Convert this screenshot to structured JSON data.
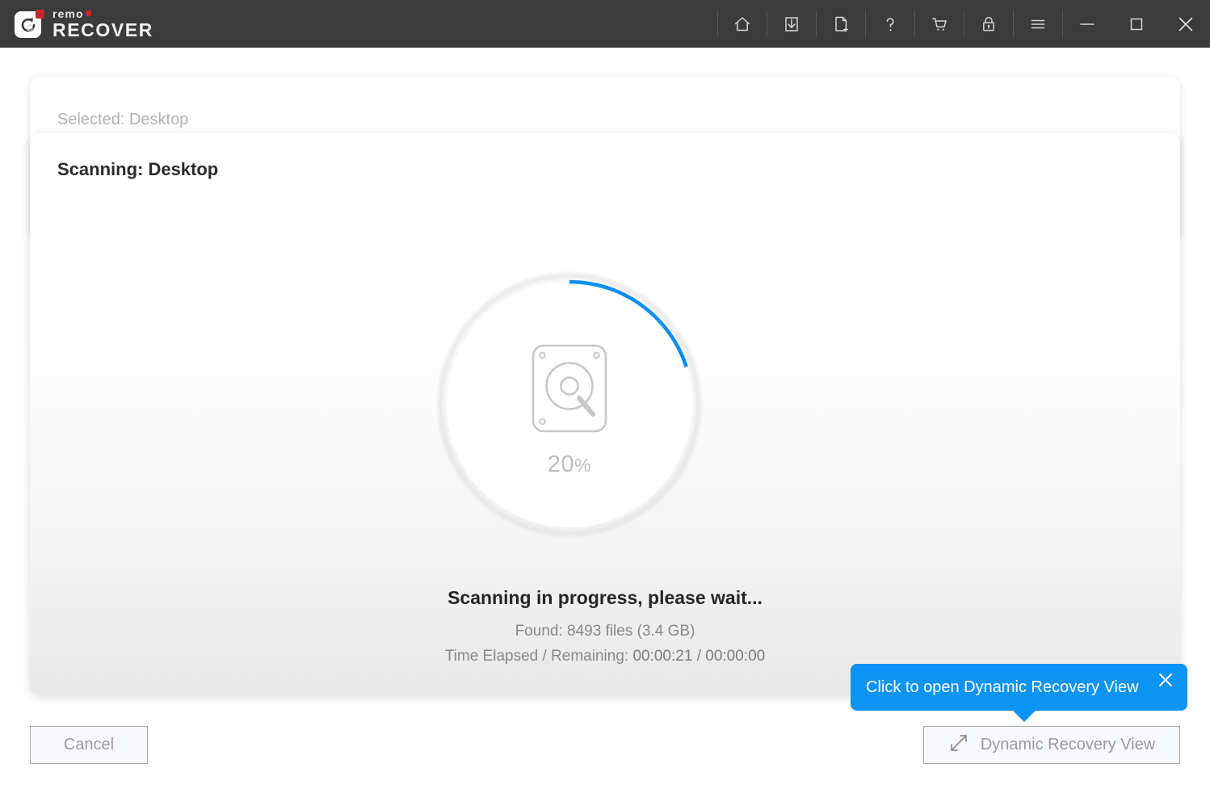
{
  "app": {
    "brand_primary": "remo",
    "brand_secondary": "RECOVER",
    "titlebar_bg": "#3b3b3b",
    "accent_blue": "#0b93f6",
    "brand_red": "#c8242c"
  },
  "titlebar": {
    "icons": [
      {
        "name": "home-icon",
        "label": "Home"
      },
      {
        "name": "save-session-icon",
        "label": "Save Recovery Session"
      },
      {
        "name": "new-file-icon",
        "label": "New Session"
      },
      {
        "name": "help-icon",
        "label": "Help"
      },
      {
        "name": "cart-icon",
        "label": "Buy Now"
      },
      {
        "name": "lock-icon",
        "label": "Activate"
      },
      {
        "name": "menu-icon",
        "label": "Menu"
      },
      {
        "name": "minimize-icon",
        "label": "Minimize"
      },
      {
        "name": "maximize-icon",
        "label": "Maximize"
      },
      {
        "name": "close-icon",
        "label": "Close"
      }
    ]
  },
  "back_card": {
    "label": "Selected: Desktop"
  },
  "front_card": {
    "title": "Scanning: Desktop"
  },
  "progress": {
    "percent_value": "20",
    "percent_unit": "%",
    "percent_number": 20,
    "arc_color": "#0b8ef0",
    "track_color": "#ffffff",
    "icon": "hard-drive-search-icon"
  },
  "status": {
    "headline": "Scanning in progress, please wait...",
    "found": "Found: 8493 files (3.4 GB)",
    "time_label": "Time Elapsed / Remaining:",
    "time_value": "00:00:21 / 00:00:00"
  },
  "tooltip": {
    "text": "Click to open Dynamic Recovery View",
    "close_icon": "close-icon"
  },
  "footer": {
    "cancel_label": "Cancel",
    "dynamic_view_label": "Dynamic Recovery View",
    "dynamic_view_icon": "expand-diagonal-icon"
  }
}
